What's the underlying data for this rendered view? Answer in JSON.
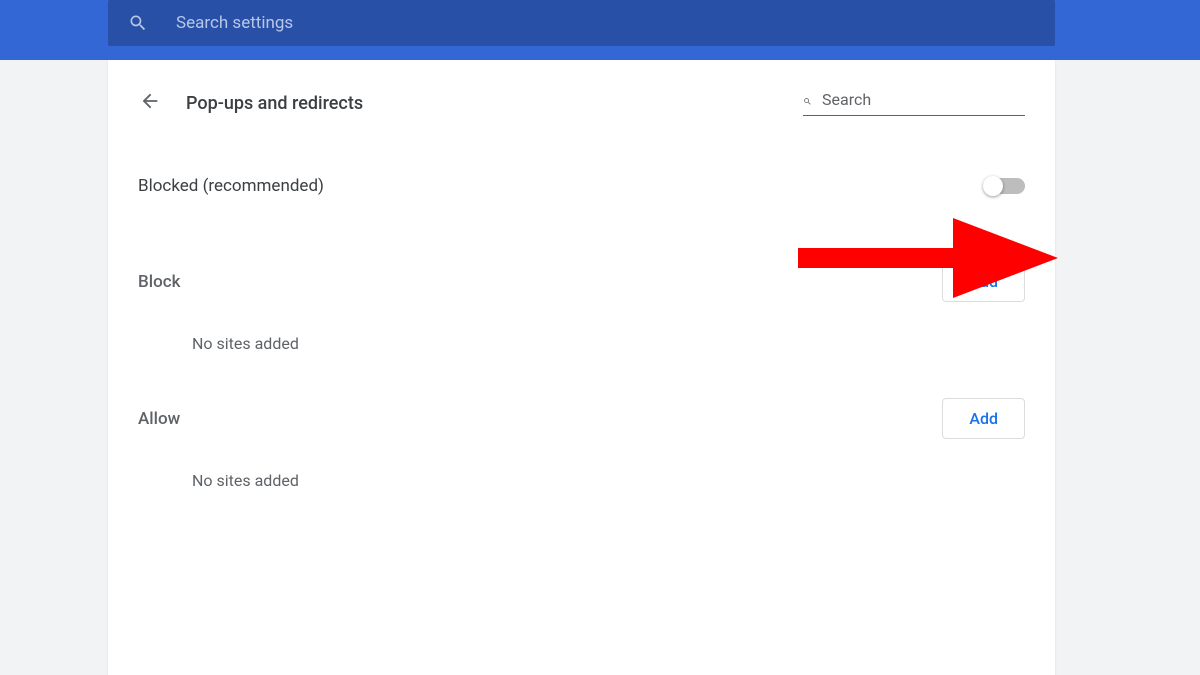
{
  "topbar": {
    "search_placeholder": "Search settings"
  },
  "header": {
    "title": "Pop-ups and redirects",
    "search_placeholder": "Search"
  },
  "toggle": {
    "label": "Blocked (recommended)",
    "state": false
  },
  "sections": {
    "block": {
      "title": "Block",
      "add_label": "Add",
      "empty_text": "No sites added"
    },
    "allow": {
      "title": "Allow",
      "add_label": "Add",
      "empty_text": "No sites added"
    }
  },
  "annotation": {
    "arrow_color": "#ff0000"
  }
}
